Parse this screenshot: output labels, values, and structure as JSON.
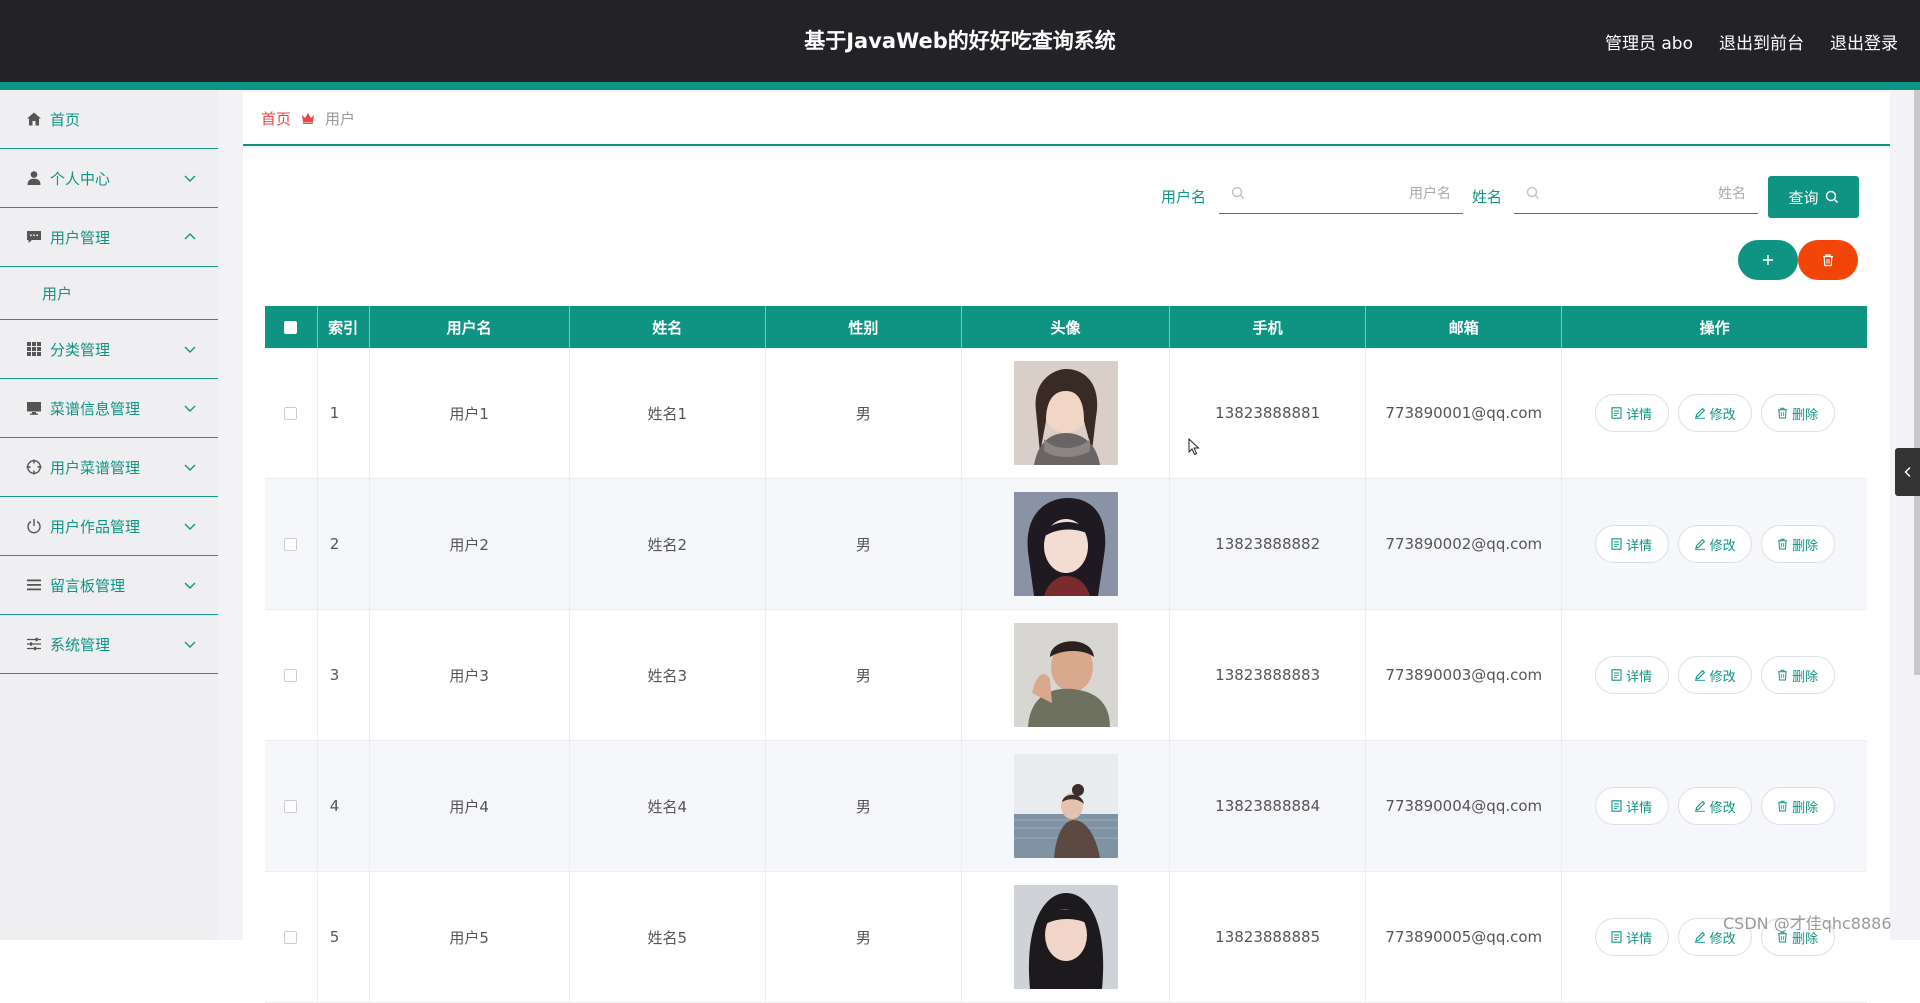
{
  "header": {
    "title": "基于JavaWeb的好好吃查询系统",
    "admin_label": "管理员 abo",
    "to_front_label": "退出到前台",
    "logout_label": "退出登录"
  },
  "sidebar": {
    "items": [
      {
        "label": "首页",
        "icon": "home-icon"
      },
      {
        "label": "个人中心",
        "icon": "person-icon"
      },
      {
        "label": "用户管理",
        "icon": "chat-icon"
      },
      {
        "label": "分类管理",
        "icon": "grid-icon"
      },
      {
        "label": "菜谱信息管理",
        "icon": "monitor-icon"
      },
      {
        "label": "用户菜谱管理",
        "icon": "target-icon"
      },
      {
        "label": "用户作品管理",
        "icon": "power-icon"
      },
      {
        "label": "留言板管理",
        "icon": "list-icon"
      },
      {
        "label": "系统管理",
        "icon": "sliders-icon"
      }
    ],
    "sub_item": "用户"
  },
  "breadcrumb": {
    "home": "首页",
    "current": "用户"
  },
  "search": {
    "username_label": "用户名",
    "username_placeholder": "用户名",
    "name_label": "姓名",
    "name_placeholder": "姓名",
    "query_label": "查询"
  },
  "table": {
    "headers": {
      "index": "索引",
      "username": "用户名",
      "name": "姓名",
      "sex": "性别",
      "avatar": "头像",
      "phone": "手机",
      "email": "邮箱",
      "ops": "操作"
    },
    "rows": [
      {
        "index": "1",
        "username": "用户1",
        "name": "姓名1",
        "sex": "男",
        "phone": "13823888881",
        "email": "773890001@qq.com"
      },
      {
        "index": "2",
        "username": "用户2",
        "name": "姓名2",
        "sex": "男",
        "phone": "13823888882",
        "email": "773890002@qq.com"
      },
      {
        "index": "3",
        "username": "用户3",
        "name": "姓名3",
        "sex": "男",
        "phone": "13823888883",
        "email": "773890003@qq.com"
      },
      {
        "index": "4",
        "username": "用户4",
        "name": "姓名4",
        "sex": "男",
        "phone": "13823888884",
        "email": "773890004@qq.com"
      },
      {
        "index": "5",
        "username": "用户5",
        "name": "姓名5",
        "sex": "男",
        "phone": "13823888885",
        "email": "773890005@qq.com"
      }
    ],
    "op_labels": {
      "detail": "详情",
      "edit": "修改",
      "delete": "删除"
    }
  },
  "watermark": "CSDN @才佳qhc8886",
  "colors": {
    "accent": "#0f9484",
    "danger": "#f2450a",
    "header_bg": "#232226",
    "breadcrumb_home": "#e8474a"
  }
}
